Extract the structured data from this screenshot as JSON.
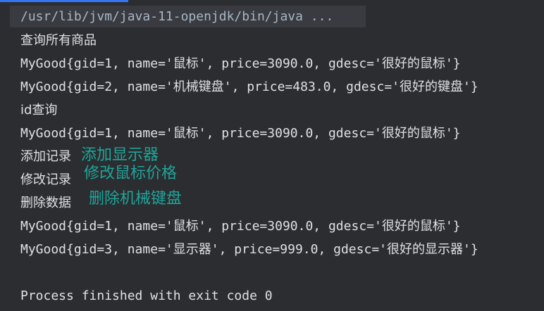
{
  "console": {
    "command": "/usr/lib/jvm/java-11-openjdk/bin/java ...",
    "lines": [
      "查询所有商品",
      "MyGood{gid=1, name='鼠标', price=3090.0, gdesc='很好的鼠标'}",
      "MyGood{gid=2, name='机械键盘', price=483.0, gdesc='很好的键盘'}",
      "id查询",
      "MyGood{gid=1, name='鼠标', price=3090.0, gdesc='很好的鼠标'}",
      "添加记录",
      "修改记录",
      "删除数据",
      "MyGood{gid=1, name='鼠标', price=3090.0, gdesc='很好的鼠标'}",
      "MyGood{gid=3, name='显示器', price=999.0, gdesc='很好的显示器'}",
      "",
      "Process finished with exit code 0"
    ]
  },
  "annotations": {
    "add": "添加显示器",
    "modify": "修改鼠标价格",
    "delete": "删除机械键盘"
  },
  "colors": {
    "background": "#2b2d30",
    "text": "#dfe1e5",
    "annotation": "#1fa59a",
    "command_highlight": "#393b40"
  }
}
